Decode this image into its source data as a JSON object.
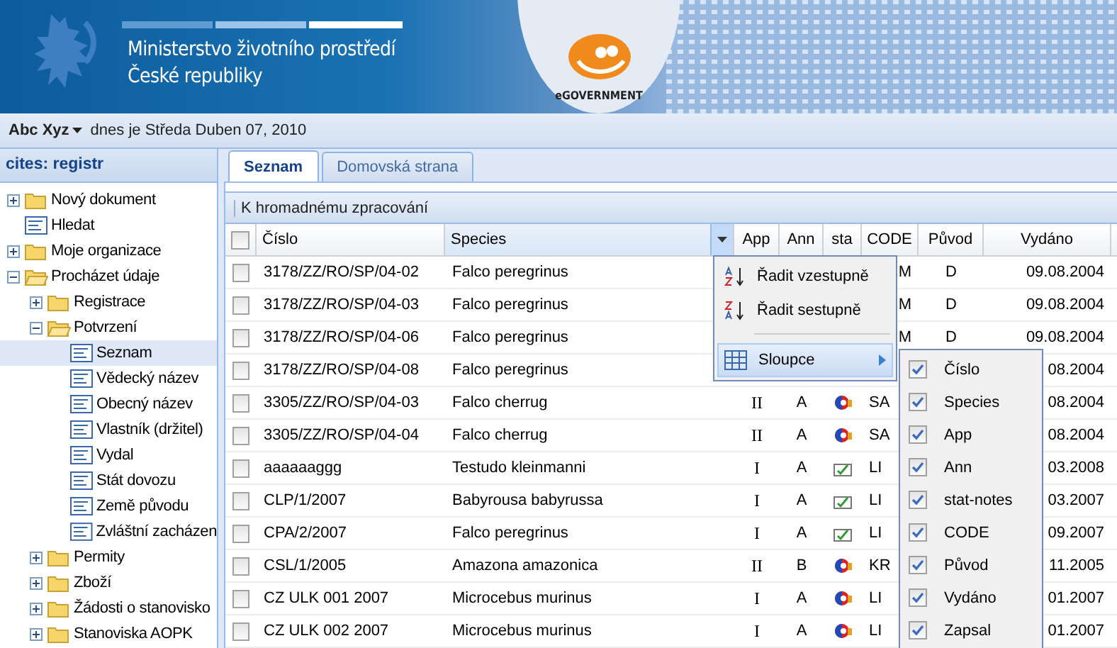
{
  "header": {
    "title_line_1": "Ministerstvo životního prostředí",
    "title_line_2": "České republiky",
    "logo_text": "eGOVERNMENT"
  },
  "user_bar": {
    "user": "Abc Xyz",
    "date_text": "dnes je Středa Duben 07, 2010"
  },
  "sidebar": {
    "title": "cites: registr",
    "items": [
      {
        "label": "Nový dokument",
        "kind": "folder",
        "expanded": false,
        "selected": false
      },
      {
        "label": "Hledat",
        "kind": "doc",
        "selected": false
      },
      {
        "label": "Moje organizace",
        "kind": "folder",
        "expanded": false,
        "selected": false
      },
      {
        "label": "Procházet údaje",
        "kind": "folder",
        "expanded": true,
        "selected": false,
        "children": [
          {
            "label": "Registrace",
            "kind": "folder",
            "expanded": false,
            "selected": false
          },
          {
            "label": "Potvrzení",
            "kind": "folder",
            "expanded": true,
            "selected": false,
            "children": [
              {
                "label": "Seznam",
                "kind": "doc",
                "selected": true
              },
              {
                "label": "Vědecký název",
                "kind": "doc",
                "selected": false
              },
              {
                "label": "Obecný název",
                "kind": "doc",
                "selected": false
              },
              {
                "label": "Vlastník (držitel)",
                "kind": "doc",
                "selected": false
              },
              {
                "label": "Vydal",
                "kind": "doc",
                "selected": false
              },
              {
                "label": "Stát dovozu",
                "kind": "doc",
                "selected": false
              },
              {
                "label": "Země původu",
                "kind": "doc",
                "selected": false
              },
              {
                "label": "Zvláštní zacházen",
                "kind": "doc",
                "selected": false
              }
            ]
          },
          {
            "label": "Permity",
            "kind": "folder",
            "expanded": false,
            "selected": false
          },
          {
            "label": "Zboží",
            "kind": "folder",
            "expanded": false,
            "selected": false
          },
          {
            "label": "Žádosti o stanovisko",
            "kind": "folder",
            "expanded": false,
            "selected": false
          },
          {
            "label": "Stanoviska AOPK",
            "kind": "folder",
            "expanded": false,
            "selected": false
          }
        ]
      }
    ]
  },
  "tabs": [
    {
      "label": "Seznam",
      "selected": true
    },
    {
      "label": "Domovská strana",
      "selected": false
    }
  ],
  "toolbar": {
    "button": "K hromadnému zpracování"
  },
  "table": {
    "all_checked": false,
    "columns": [
      {
        "label": "Číslo",
        "menu_open": false
      },
      {
        "label": "Species",
        "menu_open": true
      },
      {
        "label": "App",
        "menu_open": false
      },
      {
        "label": "Ann",
        "menu_open": false
      },
      {
        "label": "sta",
        "menu_open": false
      },
      {
        "label": "CODE",
        "menu_open": false
      },
      {
        "label": "Původ",
        "menu_open": false
      },
      {
        "label": "Vydáno",
        "menu_open": false
      }
    ],
    "rows": [
      {
        "checked": false,
        "cells": [
          "3178/ZZ/RO/SP/04-02",
          "Falco peregrinus",
          null,
          null,
          null,
          "M",
          "D",
          "09.08.2004"
        ]
      },
      {
        "checked": false,
        "cells": [
          "3178/ZZ/RO/SP/04-03",
          "Falco peregrinus",
          null,
          null,
          null,
          "M",
          "D",
          "09.08.2004"
        ]
      },
      {
        "checked": false,
        "cells": [
          "3178/ZZ/RO/SP/04-06",
          "Falco peregrinus",
          null,
          null,
          null,
          "M",
          "D",
          "09.08.2004"
        ]
      },
      {
        "checked": false,
        "cells": [
          "3178/ZZ/RO/SP/04-08",
          "Falco peregrinus",
          null,
          null,
          null,
          null,
          null,
          "08.2004"
        ]
      },
      {
        "checked": false,
        "kind": "flag",
        "cells": [
          "3305/ZZ/RO/SP/04-03",
          "Falco cherrug",
          "II",
          "A",
          null,
          "SA",
          null,
          "08.2004"
        ]
      },
      {
        "checked": false,
        "kind": "flag",
        "cells": [
          "3305/ZZ/RO/SP/04-04",
          "Falco cherrug",
          "II",
          "A",
          null,
          "SA",
          null,
          "08.2004"
        ]
      },
      {
        "checked": false,
        "kind": "check",
        "cells": [
          "aaaaaaggg",
          "Testudo kleinmanni",
          "I",
          "A",
          null,
          "LI",
          null,
          "03.2008"
        ]
      },
      {
        "checked": false,
        "kind": "check",
        "cells": [
          "CLP/1/2007",
          "Babyrousa babyrussa",
          "I",
          "A",
          null,
          "LI",
          null,
          "03.2007"
        ]
      },
      {
        "checked": false,
        "kind": "check",
        "cells": [
          "CPA/2/2007",
          "Falco peregrinus",
          "I",
          "A",
          null,
          "LI",
          null,
          "09.2007"
        ]
      },
      {
        "checked": false,
        "kind": "flag",
        "cells": [
          "CSL/1/2005",
          "Amazona amazonica",
          "II",
          "B",
          null,
          "KR",
          null,
          "11.2005"
        ]
      },
      {
        "checked": false,
        "kind": "flag",
        "cells": [
          "CZ ULK 001 2007",
          "Microcebus murinus",
          "I",
          "A",
          null,
          "LI",
          null,
          "01.2007"
        ]
      },
      {
        "checked": false,
        "kind": "flag",
        "cells": [
          "CZ ULK 002 2007",
          "Microcebus murinus",
          "I",
          "A",
          null,
          "LI",
          null,
          "01.2007"
        ]
      }
    ]
  },
  "column_menu": {
    "items": [
      {
        "label": "Řadit vzestupně",
        "kind": "sort_asc",
        "selected": false
      },
      {
        "label": "Řadit sestupně",
        "kind": "sort_desc",
        "selected": false
      },
      {
        "label": "Sloupce",
        "kind": "submenu",
        "selected": true
      }
    ]
  },
  "columns_submenu": {
    "items": [
      {
        "label": "Číslo",
        "checked": true
      },
      {
        "label": "Species",
        "checked": true
      },
      {
        "label": "App",
        "checked": true
      },
      {
        "label": "Ann",
        "checked": true
      },
      {
        "label": "stat-notes",
        "checked": true
      },
      {
        "label": "CODE",
        "checked": true
      },
      {
        "label": "Původ",
        "checked": true
      },
      {
        "label": "Vydáno",
        "checked": true
      },
      {
        "label": "Zapsal",
        "checked": true
      }
    ]
  }
}
